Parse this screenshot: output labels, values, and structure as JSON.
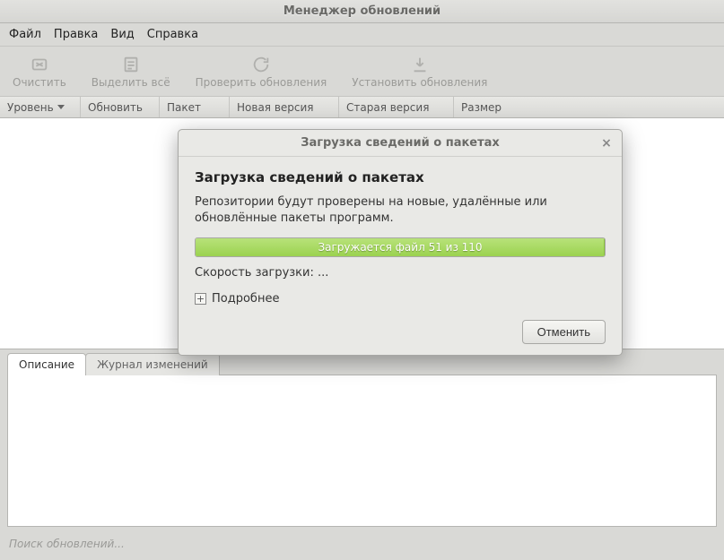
{
  "window": {
    "title": "Менеджер обновлений"
  },
  "menu": {
    "file": "Файл",
    "edit": "Правка",
    "view": "Вид",
    "help": "Справка"
  },
  "toolbar": {
    "clear": "Очистить",
    "select_all": "Выделить всё",
    "check": "Проверить обновления",
    "install": "Установить обновления"
  },
  "columns": {
    "level": "Уровень",
    "update": "Обновить",
    "package": "Пакет",
    "new_version": "Новая версия",
    "old_version": "Старая версия",
    "size": "Размер"
  },
  "tabs": {
    "description": "Описание",
    "changelog": "Журнал изменений"
  },
  "status": {
    "text": "Поиск обновлений..."
  },
  "dialog": {
    "title": "Загрузка сведений о пакетах",
    "heading": "Загрузка сведений о пакетах",
    "message": "Репозитории будут проверены на новые, удалённые или обновлённые пакеты программ.",
    "progress_label": "Загружается файл 51 из 110",
    "speed_label": "Скорость загрузки: ...",
    "details": "Подробнее",
    "cancel": "Отменить"
  }
}
